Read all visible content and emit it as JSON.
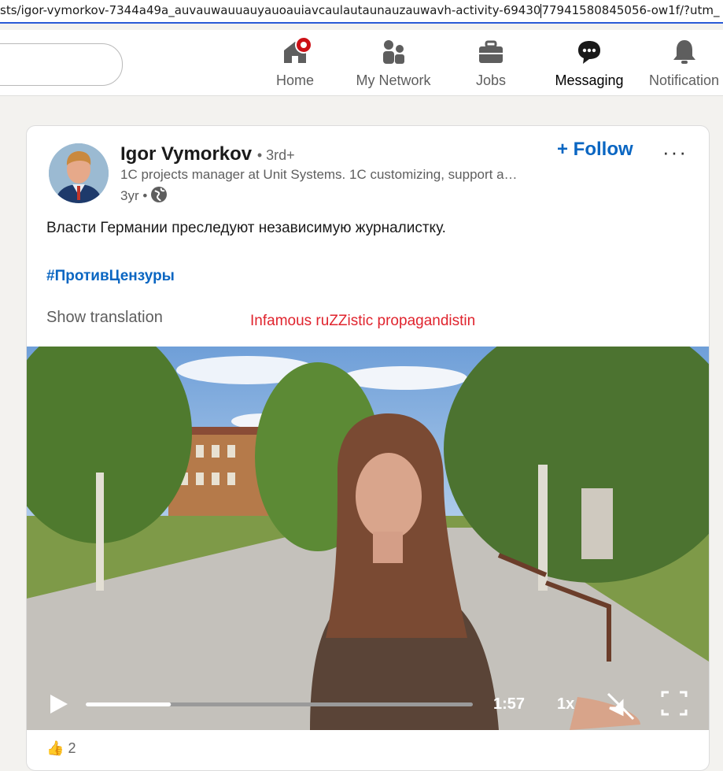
{
  "browser": {
    "url_left": "sts/igor-vymorkov-7344a49a_auvauwauuauyauoauiavcaulautaunauzauwavh-activity-69430",
    "url_right": "77941580845056-ow1f/?utm_"
  },
  "nav": {
    "items": [
      {
        "label": "Home",
        "icon": "home-icon",
        "badge": true
      },
      {
        "label": "My Network",
        "icon": "people-icon"
      },
      {
        "label": "Jobs",
        "icon": "briefcase-icon"
      },
      {
        "label": "Messaging",
        "icon": "chat-icon",
        "active": true
      },
      {
        "label": "Notification",
        "icon": "bell-icon"
      }
    ]
  },
  "post": {
    "author": "Igor Vymorkov",
    "degree": "• 3rd+",
    "headline": "1C projects manager at Unit Systems. 1C customizing, support a…",
    "time": "3yr •",
    "follow": "+ Follow",
    "more": "···",
    "text": "Власти Германии преследуют независимую журналистку.",
    "hashtag": "#ПротивЦензуры",
    "show_translation": "Show translation",
    "annotation": "Infamous ruZZistic propagandistin",
    "annotation_color": "#e0242e",
    "reactions_count": "2"
  },
  "video": {
    "duration": "1:57",
    "speed": "1x",
    "progress": 0.22
  }
}
